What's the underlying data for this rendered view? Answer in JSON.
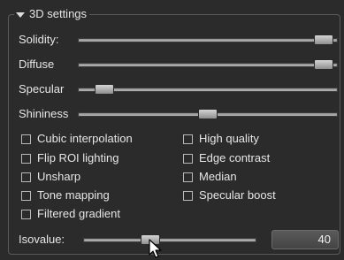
{
  "panel": {
    "title": "3D settings"
  },
  "sliders": {
    "solidity": {
      "label": "Solidity:",
      "value": 0.98
    },
    "diffuse": {
      "label": "Diffuse",
      "value": 0.98
    },
    "specular": {
      "label": "Specular",
      "value": 0.07
    },
    "shininess": {
      "label": "Shininess",
      "value": 0.5
    }
  },
  "options": [
    {
      "label": "Cubic interpolation",
      "checked": false
    },
    {
      "label": "High quality",
      "checked": false
    },
    {
      "label": "Flip ROI lighting",
      "checked": false
    },
    {
      "label": "Edge contrast",
      "checked": false
    },
    {
      "label": "Unsharp",
      "checked": false
    },
    {
      "label": "Median",
      "checked": false
    },
    {
      "label": "Tone mapping",
      "checked": false
    },
    {
      "label": "Specular boost",
      "checked": false
    },
    {
      "label": "Filtered gradient",
      "checked": false
    }
  ],
  "isovalue": {
    "label": "Isovalue:",
    "value": 40,
    "display": "40"
  },
  "colors": {
    "background": "#2b2b2b",
    "text": "#e6e6e6"
  }
}
